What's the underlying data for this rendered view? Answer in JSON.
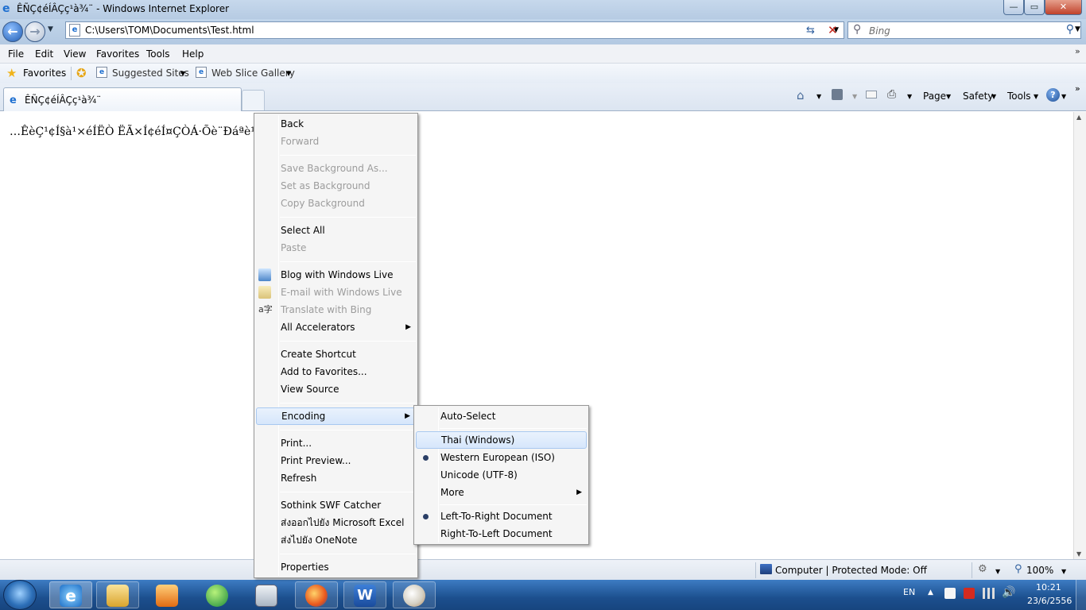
{
  "window": {
    "title": "ÊÑÇ¢éÍÂÇç¹à¾¨ - Windows Internet Explorer",
    "minimize": "—",
    "restore": "▭",
    "close": "✕"
  },
  "address": {
    "url": "C:\\Users\\TOM\\Documents\\Test.html",
    "search_placeholder": "Bing"
  },
  "menubar": [
    "File",
    "Edit",
    "View",
    "Favorites",
    "Tools",
    "Help"
  ],
  "favbar": {
    "favorites": "Favorites",
    "suggested": "Suggested Sites",
    "webslice": "Web Slice Gallery"
  },
  "tab": {
    "title": "ÊÑÇ¢éÍÂÇç¹à¾¨"
  },
  "commandbar": {
    "page": "Page",
    "safety": "Safety",
    "tools": "Tools"
  },
  "content": {
    "text": "…ÊèÇ¹¢Í§à¹×éÍËÒ ËÃ×Í¢éÍ¤ÇÒÁ·Õè¨Ðáªè¹áÊ´§"
  },
  "context_menu": {
    "back": "Back",
    "forward": "Forward",
    "save_bg": "Save Background As...",
    "set_bg": "Set as Background",
    "copy_bg": "Copy Background",
    "select_all": "Select All",
    "paste": "Paste",
    "blog": "Blog with Windows Live",
    "email": "E-mail with Windows Live",
    "translate": "Translate with Bing",
    "accelerators": "All Accelerators",
    "shortcut": "Create Shortcut",
    "add_fav": "Add to Favorites...",
    "view_source": "View Source",
    "encoding": "Encoding",
    "print": "Print...",
    "print_preview": "Print Preview...",
    "refresh": "Refresh",
    "swf": "Sothink SWF Catcher",
    "excel": "ส่งออกไปยัง Microsoft Excel",
    "onenote": "ส่งไปยัง OneNote",
    "properties": "Properties"
  },
  "encoding_menu": {
    "auto": "Auto-Select",
    "thai": "Thai (Windows)",
    "western": "Western European (ISO)",
    "unicode": "Unicode (UTF-8)",
    "more": "More",
    "ltr": "Left-To-Right Document",
    "rtl": "Right-To-Left Document"
  },
  "status": {
    "zone": "Computer | Protected Mode: Off",
    "zoom": "100%"
  },
  "taskbar": {
    "lang": "EN",
    "time": "10:21",
    "date": "23/6/2556"
  },
  "colors": {
    "accent": "#3d7cc3",
    "menu_highlight": "#d6e6fb"
  }
}
